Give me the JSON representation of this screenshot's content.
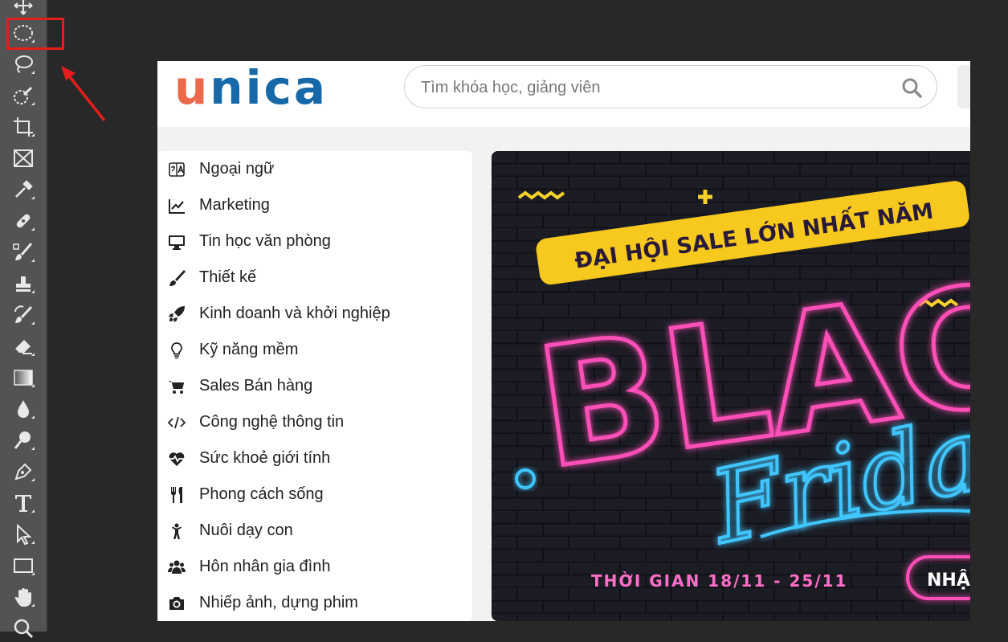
{
  "site": {
    "logo_u": "u",
    "logo_rest": "nica",
    "search_placeholder": "Tìm khóa học, giảng viên"
  },
  "categories": [
    {
      "label": "Ngoại ngữ",
      "icon": "language-icon"
    },
    {
      "label": "Marketing",
      "icon": "line-chart-icon"
    },
    {
      "label": "Tin học văn phòng",
      "icon": "desktop-icon"
    },
    {
      "label": "Thiết kế",
      "icon": "paint-brush-icon"
    },
    {
      "label": "Kinh doanh và khởi nghiệp",
      "icon": "rocket-icon"
    },
    {
      "label": "Kỹ năng mềm",
      "icon": "lightbulb-icon"
    },
    {
      "label": "Sales Bán hàng",
      "icon": "shopping-cart-icon"
    },
    {
      "label": "Công nghệ thông tin",
      "icon": "code-icon"
    },
    {
      "label": "Sức khoẻ giới tính",
      "icon": "heartbeat-icon"
    },
    {
      "label": "Phong cách sống",
      "icon": "cutlery-icon"
    },
    {
      "label": "Nuôi dạy con",
      "icon": "child-icon"
    },
    {
      "label": "Hôn nhân gia đình",
      "icon": "users-icon"
    },
    {
      "label": "Nhiếp ảnh, dựng phim",
      "icon": "camera-icon"
    }
  ],
  "banner": {
    "ribbon_text": "ĐẠI HỘI SALE LỚN NHẤT NĂM",
    "headline": "BLACK",
    "script_text": "Friday",
    "period_text": "THỜI GIAN 18/11 - 25/11",
    "cta_text": "NHẬN"
  },
  "colors": {
    "highlight_red": "#e51d1d",
    "logo_orange": "#ec6a4c",
    "logo_blue": "#1668a8",
    "neon_pink": "#ff4fb8",
    "neon_blue": "#3fc6ff",
    "ribbon_yellow": "#f7c81d"
  },
  "toolbar_tools": [
    "move-tool-icon",
    "elliptical-marquee-tool-icon",
    "lasso-tool-icon",
    "quick-selection-tool-icon",
    "crop-tool-icon",
    "frame-tool-icon",
    "eyedropper-tool-icon",
    "spot-healing-brush-icon",
    "brush-tool-icon",
    "clone-stamp-tool-icon",
    "history-brush-icon",
    "eraser-tool-icon",
    "gradient-tool-icon",
    "blur-tool-icon",
    "dodge-tool-icon",
    "pen-tool-icon",
    "type-tool-icon",
    "path-selection-tool-icon",
    "rectangle-tool-icon",
    "hand-tool-icon",
    "zoom-tool-icon"
  ]
}
